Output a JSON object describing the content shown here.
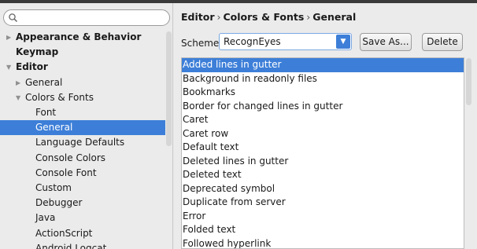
{
  "search": {
    "placeholder": ""
  },
  "sidebar": {
    "items": [
      {
        "label": "Appearance & Behavior",
        "arrow": "▶",
        "bold": true
      },
      {
        "label": "Keymap",
        "arrow": "",
        "bold": true
      },
      {
        "label": "Editor",
        "arrow": "▼",
        "bold": true
      },
      {
        "label": "General",
        "arrow": "▶",
        "bold": false
      },
      {
        "label": "Colors & Fonts",
        "arrow": "▼",
        "bold": false
      },
      {
        "label": "Font",
        "arrow": "",
        "bold": false
      },
      {
        "label": "General",
        "arrow": "",
        "bold": false,
        "selected": true
      },
      {
        "label": "Language Defaults",
        "arrow": "",
        "bold": false
      },
      {
        "label": "Console Colors",
        "arrow": "",
        "bold": false
      },
      {
        "label": "Console Font",
        "arrow": "",
        "bold": false
      },
      {
        "label": "Custom",
        "arrow": "",
        "bold": false
      },
      {
        "label": "Debugger",
        "arrow": "",
        "bold": false
      },
      {
        "label": "Java",
        "arrow": "",
        "bold": false
      },
      {
        "label": "ActionScript",
        "arrow": "",
        "bold": false
      },
      {
        "label": "Android Logcat",
        "arrow": "",
        "bold": false
      }
    ]
  },
  "breadcrumb": {
    "part1": "Editor",
    "part2": "Colors & Fonts",
    "part3": "General",
    "sep": "›"
  },
  "scheme": {
    "label": "Scheme:",
    "value": "RecognEyes"
  },
  "buttons": {
    "save_as": "Save As...",
    "delete": "Delete"
  },
  "list": {
    "items": [
      {
        "label": "Added lines in gutter",
        "selected": true
      },
      {
        "label": "Background in readonly files"
      },
      {
        "label": "Bookmarks"
      },
      {
        "label": "Border for changed lines in gutter"
      },
      {
        "label": "Caret"
      },
      {
        "label": "Caret row"
      },
      {
        "label": "Default text"
      },
      {
        "label": "Deleted lines in gutter"
      },
      {
        "label": "Deleted text"
      },
      {
        "label": "Deprecated symbol"
      },
      {
        "label": "Duplicate from server"
      },
      {
        "label": "Error"
      },
      {
        "label": "Folded text"
      },
      {
        "label": "Followed hyperlink"
      }
    ]
  },
  "colors": {
    "selection": "#3d7fd8"
  }
}
